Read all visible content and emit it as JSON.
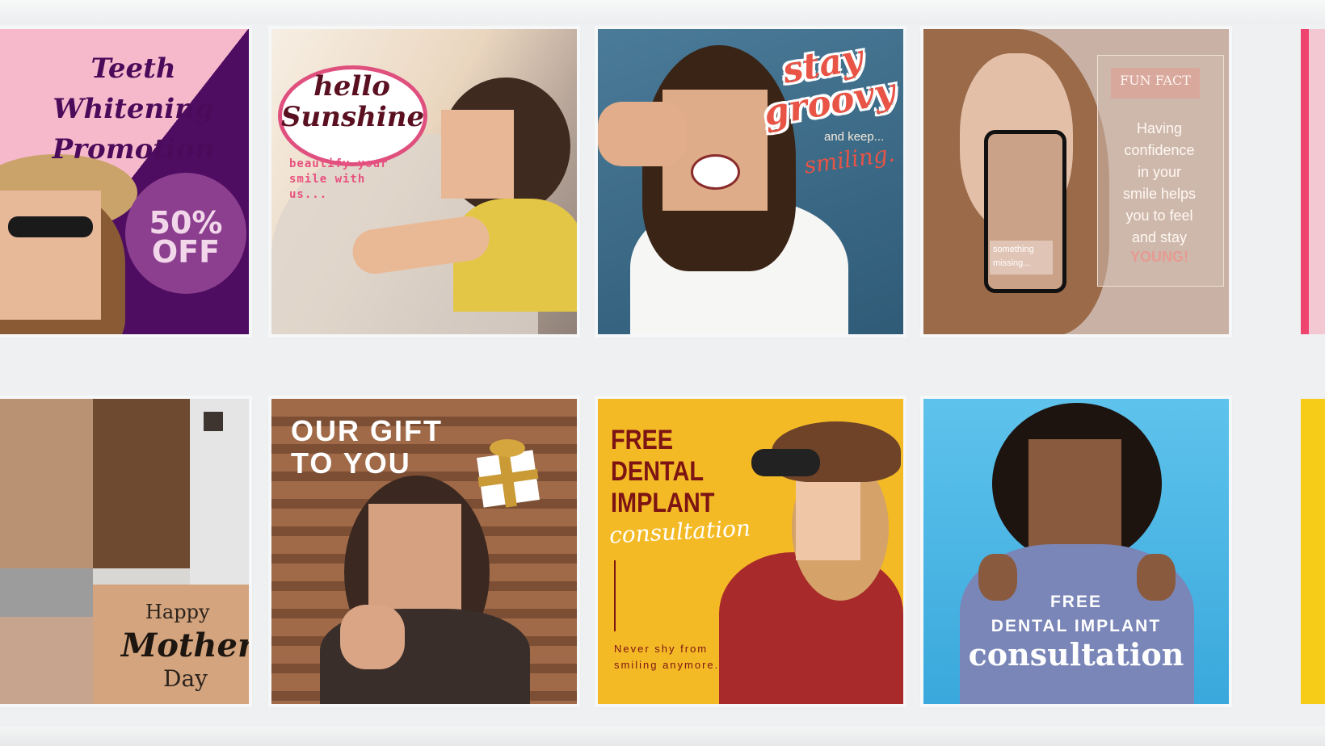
{
  "cards": [
    {
      "id": "teeth-whitening",
      "title": "Teeth Whitening\nPromotion",
      "badge": "50%\nOFF",
      "colors": {
        "bg": "#f6b9cb",
        "accent": "#4f0d62",
        "badge": "#8c3f8f"
      }
    },
    {
      "id": "hello-sunshine",
      "title": "hello\nSunshine",
      "tagline": "beautify your\nsmile with\nus...",
      "colors": {
        "accent": "#e8517f"
      }
    },
    {
      "id": "stay-groovy",
      "title": "stay\ngroovy",
      "line1": "and keep...",
      "line2": "smiling.",
      "colors": {
        "bg": "#3c6e8d",
        "accent": "#e85445"
      }
    },
    {
      "id": "fun-fact",
      "badge": "FUN FACT",
      "text": "Having\nconfidence\nin your\nsmile helps\nyou to feel\nand stay",
      "highlight": "YOUNG!",
      "phone_label": "something\nmissing...",
      "colors": {
        "bg": "#c9b2a5",
        "accent": "#e59a92"
      }
    },
    {
      "id": "mothers-day",
      "line1": "Happy",
      "line2": "Mother's",
      "line3": "Day"
    },
    {
      "id": "our-gift",
      "title": "OUR GIFT\nTO YOU",
      "icon": "gift-box-icon"
    },
    {
      "id": "dental-implant-yellow",
      "title": "FREE\nDENTAL\nIMPLANT",
      "script": "consultation",
      "footer": "Never shy from\nsmiling anymore.",
      "colors": {
        "bg": "#f4ba26",
        "accent": "#7c1414"
      }
    },
    {
      "id": "dental-implant-blue",
      "line1": "FREE",
      "line2": "DENTAL IMPLANT",
      "line3": "consultation",
      "colors": {
        "bg": "#4fb8e5"
      }
    }
  ]
}
